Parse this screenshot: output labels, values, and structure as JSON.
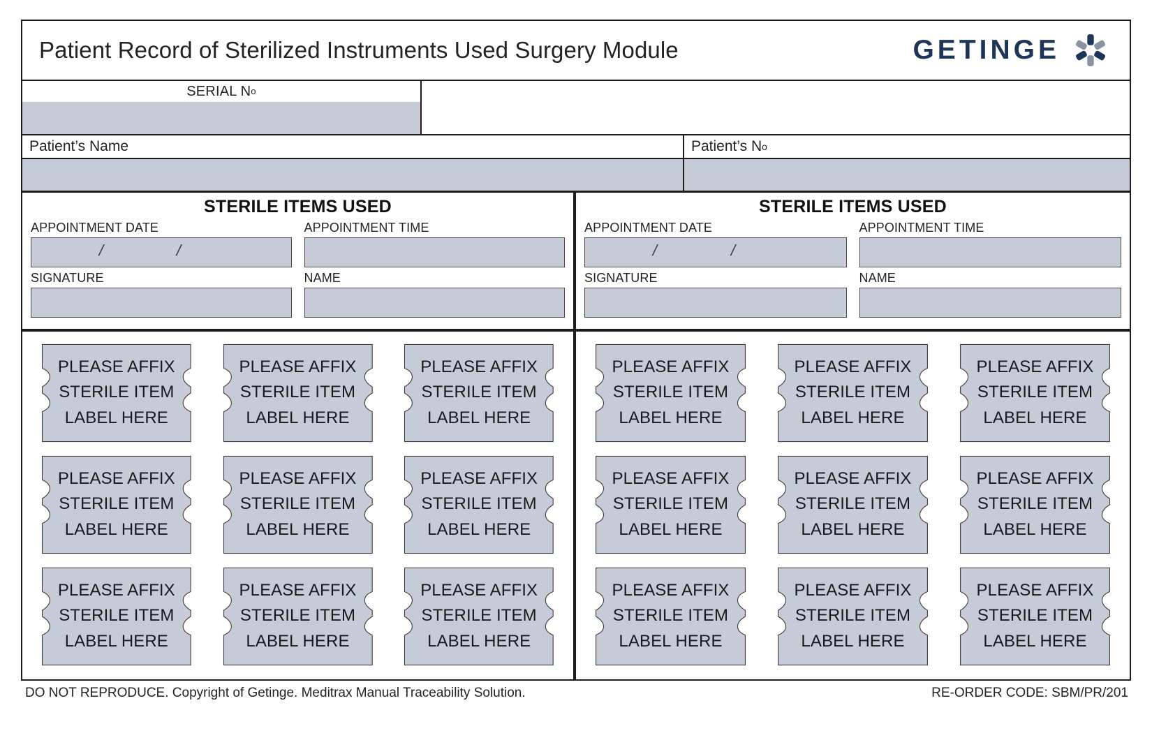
{
  "header": {
    "title": "Patient Record of Sterilized Instruments Used Surgery Module",
    "brand_name": "GETINGE",
    "brand_mark_icon": "getinge-asterisk-icon",
    "brand_navy": "#1d3557",
    "brand_gray": "#8a93a3"
  },
  "serial": {
    "label": "SERIAL N",
    "label_sup": "o",
    "value": ""
  },
  "patient": {
    "name_label": "Patient’s Name",
    "name_value": "",
    "number_label": "Patient’s N",
    "number_label_sup": "o",
    "number_value": ""
  },
  "field_fill_color": "#c6cbd8",
  "panels": [
    {
      "heading": "STERILE ITEMS USED",
      "fields": [
        {
          "label": "APPOINTMENT DATE",
          "value": "",
          "separators": [
            "/",
            "/"
          ]
        },
        {
          "label": "APPOINTMENT TIME",
          "value": ""
        },
        {
          "label": "SIGNATURE",
          "value": ""
        },
        {
          "label": "NAME",
          "value": ""
        }
      ],
      "stickers": [
        {
          "line1": "PLEASE AFFIX",
          "line2": "STERILE ITEM",
          "line3": "LABEL HERE"
        },
        {
          "line1": "PLEASE AFFIX",
          "line2": "STERILE ITEM",
          "line3": "LABEL HERE"
        },
        {
          "line1": "PLEASE AFFIX",
          "line2": "STERILE ITEM",
          "line3": "LABEL HERE"
        },
        {
          "line1": "PLEASE AFFIX",
          "line2": "STERILE ITEM",
          "line3": "LABEL HERE"
        },
        {
          "line1": "PLEASE AFFIX",
          "line2": "STERILE ITEM",
          "line3": "LABEL HERE"
        },
        {
          "line1": "PLEASE AFFIX",
          "line2": "STERILE ITEM",
          "line3": "LABEL HERE"
        },
        {
          "line1": "PLEASE AFFIX",
          "line2": "STERILE ITEM",
          "line3": "LABEL HERE"
        },
        {
          "line1": "PLEASE AFFIX",
          "line2": "STERILE ITEM",
          "line3": "LABEL HERE"
        },
        {
          "line1": "PLEASE AFFIX",
          "line2": "STERILE ITEM",
          "line3": "LABEL HERE"
        }
      ]
    },
    {
      "heading": "STERILE ITEMS USED",
      "fields": [
        {
          "label": "APPOINTMENT DATE",
          "value": "",
          "separators": [
            "/",
            "/"
          ]
        },
        {
          "label": "APPOINTMENT TIME",
          "value": ""
        },
        {
          "label": "SIGNATURE",
          "value": ""
        },
        {
          "label": "NAME",
          "value": ""
        }
      ],
      "stickers": [
        {
          "line1": "PLEASE AFFIX",
          "line2": "STERILE ITEM",
          "line3": "LABEL HERE"
        },
        {
          "line1": "PLEASE AFFIX",
          "line2": "STERILE ITEM",
          "line3": "LABEL HERE"
        },
        {
          "line1": "PLEASE AFFIX",
          "line2": "STERILE ITEM",
          "line3": "LABEL HERE"
        },
        {
          "line1": "PLEASE AFFIX",
          "line2": "STERILE ITEM",
          "line3": "LABEL HERE"
        },
        {
          "line1": "PLEASE AFFIX",
          "line2": "STERILE ITEM",
          "line3": "LABEL HERE"
        },
        {
          "line1": "PLEASE AFFIX",
          "line2": "STERILE ITEM",
          "line3": "LABEL HERE"
        },
        {
          "line1": "PLEASE AFFIX",
          "line2": "STERILE ITEM",
          "line3": "LABEL HERE"
        },
        {
          "line1": "PLEASE AFFIX",
          "line2": "STERILE ITEM",
          "line3": "LABEL HERE"
        },
        {
          "line1": "PLEASE AFFIX",
          "line2": "STERILE ITEM",
          "line3": "LABEL HERE"
        }
      ]
    }
  ],
  "footer": {
    "copyright": "DO NOT REPRODUCE. Copyright of Getinge. Meditrax Manual Traceability Solution.",
    "reorder_code": "RE-ORDER CODE: SBM/PR/201"
  }
}
